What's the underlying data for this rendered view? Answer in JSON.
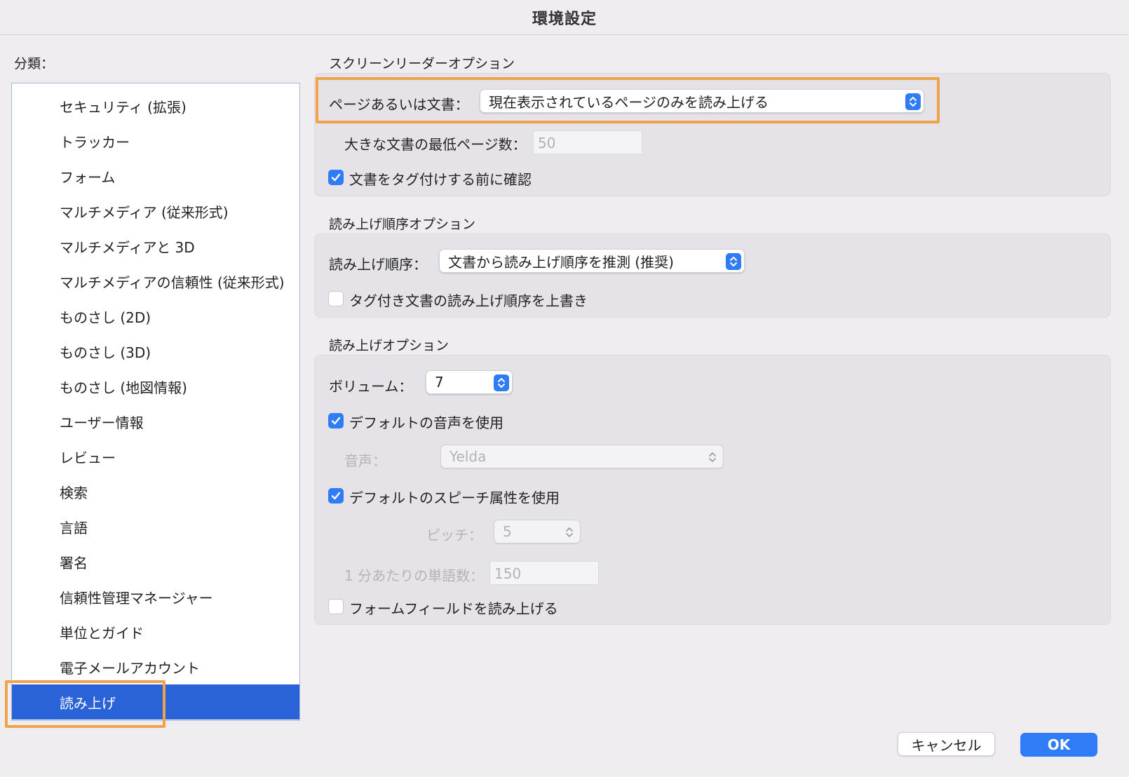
{
  "window": {
    "title": "環境設定"
  },
  "sidebar": {
    "label": "分類：",
    "items": [
      "セキュリティ (拡張)",
      "トラッカー",
      "フォーム",
      "マルチメディア (従来形式)",
      "マルチメディアと 3D",
      "マルチメディアの信頼性 (従来形式)",
      "ものさし (2D)",
      "ものさし (3D)",
      "ものさし (地図情報)",
      "ユーザー情報",
      "レビュー",
      "検索",
      "言語",
      "署名",
      "信頼性管理マネージャー",
      "単位とガイド",
      "電子メールアカウント",
      "読み上げ"
    ],
    "selected": "読み上げ"
  },
  "screen_reader": {
    "title": "スクリーンリーダーオプション",
    "page_or_doc_label": "ページあるいは文書：",
    "page_or_doc_value": "現在表示されているページのみを読み上げる",
    "min_pages_label": "大きな文書の最低ページ数：",
    "min_pages_value": "50",
    "confirm_tag_label": "文書をタグ付けする前に確認",
    "confirm_tag_checked": true
  },
  "reading_order": {
    "title": "読み上げ順序オプション",
    "order_label": "読み上げ順序：",
    "order_value": "文書から読み上げ順序を推測 (推奨)",
    "override_label": "タグ付き文書の読み上げ順序を上書き",
    "override_checked": false
  },
  "read_out": {
    "title": "読み上げオプション",
    "volume_label": "ボリューム：",
    "volume_value": "7",
    "default_voice_label": "デフォルトの音声を使用",
    "default_voice_checked": true,
    "voice_label": "音声：",
    "voice_value": "Yelda",
    "default_speech_label": "デフォルトのスピーチ属性を使用",
    "default_speech_checked": true,
    "pitch_label": "ピッチ：",
    "pitch_value": "5",
    "wpm_label": "1 分あたりの単語数：",
    "wpm_value": "150",
    "form_fields_label": "フォームフィールドを読み上げる",
    "form_fields_checked": false
  },
  "buttons": {
    "cancel": "キャンセル",
    "ok": "OK"
  },
  "colors": {
    "accent": "#2f7cf6",
    "selection": "#2a62d8",
    "highlight": "#f0a348"
  }
}
